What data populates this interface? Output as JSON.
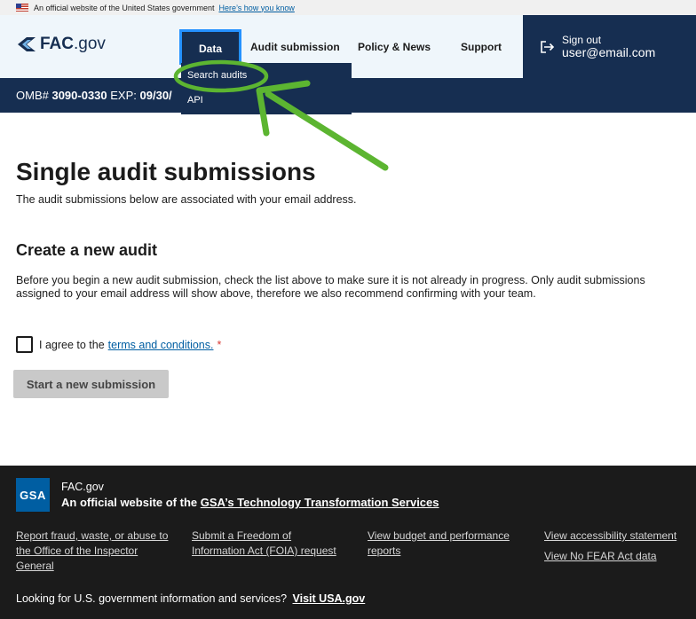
{
  "gov_banner": {
    "text": "An official website of the United States government",
    "link": "Here’s how you know"
  },
  "header": {
    "logo_bold": "FAC",
    "logo_rest": ".gov",
    "nav": {
      "data": "Data",
      "audit_submission": "Audit submission",
      "policy_news": "Policy & News",
      "support": "Support"
    },
    "signout_label": "Sign out",
    "user_email": "user@email.com"
  },
  "dropdown": {
    "items": [
      "Search audits",
      "API"
    ]
  },
  "omb": {
    "prefix": "OMB#",
    "number": "3090-0330",
    "exp_label": "EXP:",
    "exp_value": "09/30/"
  },
  "main": {
    "title": "Single audit submissions",
    "subtitle": "The audit submissions below are associated with your email address.",
    "create_title": "Create a new audit",
    "create_text": "Before you begin a new audit submission, check the list above to make sure it is not already in progress. Only audit submissions assigned to your email address will show above, therefore we also recommend confirming with your team.",
    "agree_prefix": "I agree to the",
    "terms_link": "terms and conditions.",
    "required_mark": "*",
    "start_button": "Start a new submission"
  },
  "footer": {
    "gsa_logo": "GSA",
    "site_name": "FAC.gov",
    "official_prefix": "An official website of the",
    "official_link": "GSA’s Technology Transformation Services",
    "links": {
      "report_fraud": "Report fraud, waste, or abuse to the Office of the Inspector General",
      "foia": "Submit a Freedom of Information Act (FOIA) request",
      "budget": "View budget and performance reports",
      "accessibility": "View accessibility statement",
      "no_fear": "View No FEAR Act data"
    },
    "usa_prefix": "Looking for U.S. government information and services?",
    "usa_link": "Visit USA.gov"
  },
  "colors": {
    "navy": "#162e51",
    "light_blue": "#eff6fb",
    "link": "#005ea2",
    "annotation": "#5cb531",
    "footer_bg": "#1b1b1b"
  }
}
